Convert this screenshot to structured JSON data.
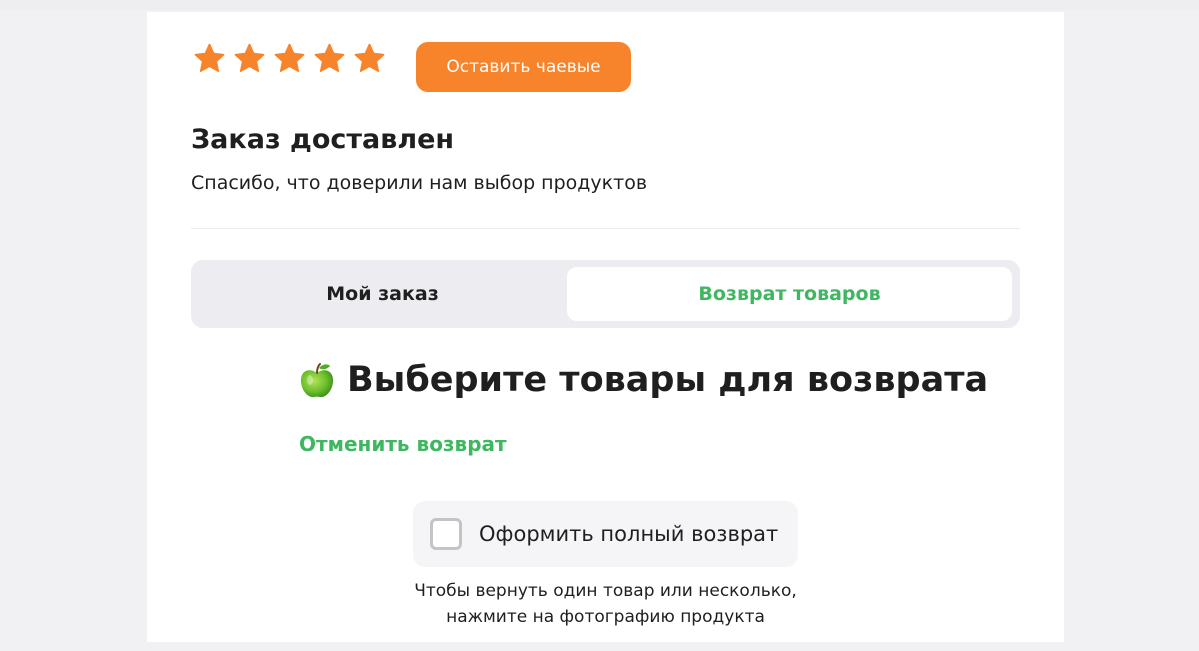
{
  "rating": {
    "stars_filled": 5,
    "stars_total": 5,
    "star_color": "#f7832a",
    "tip_button_label": "Оставить чаевые",
    "tip_button_color": "#f7832a"
  },
  "status": {
    "title": "Заказ доставлен",
    "subtitle": "Спасибо, что доверили нам выбор продуктов"
  },
  "tabs": [
    {
      "label": "Мой заказ",
      "active": false
    },
    {
      "label": "Возврат товаров",
      "active": true
    }
  ],
  "accent_green": "#3fb760",
  "return_section": {
    "icon": "green-apple-icon",
    "heading": "Выберите товары для возврата",
    "cancel_label": "Отменить возврат",
    "full_return_label": "Оформить полный возврат",
    "full_return_checked": false,
    "hint_line1": "Чтобы вернуть один товар или несколько,",
    "hint_line2": "нажмите на фотографию продукта"
  }
}
